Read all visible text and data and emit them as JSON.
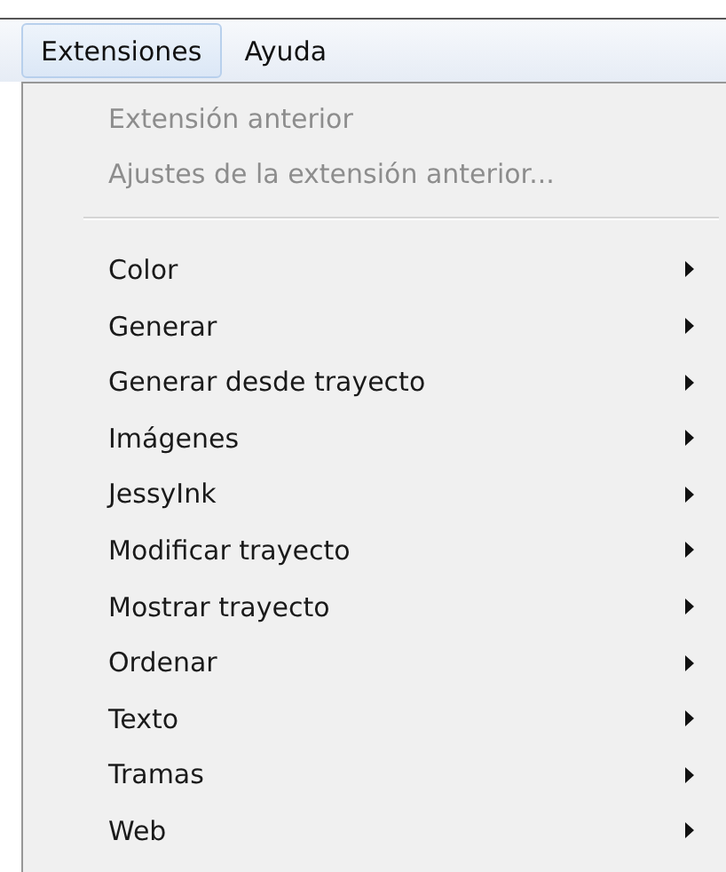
{
  "menubar": [
    {
      "label": "Extensiones",
      "selected": true
    },
    {
      "label": "Ayuda",
      "selected": false
    }
  ],
  "menu": [
    {
      "kind": "item",
      "label": "Extensión anterior",
      "disabled": true,
      "submenu": false
    },
    {
      "kind": "item",
      "label": "Ajustes de la extensión anterior...",
      "disabled": true,
      "submenu": false
    },
    {
      "kind": "separator"
    },
    {
      "kind": "item",
      "label": "Color",
      "disabled": false,
      "submenu": true
    },
    {
      "kind": "item",
      "label": "Generar",
      "disabled": false,
      "submenu": true
    },
    {
      "kind": "item",
      "label": "Generar desde trayecto",
      "disabled": false,
      "submenu": true
    },
    {
      "kind": "item",
      "label": "Imágenes",
      "disabled": false,
      "submenu": true
    },
    {
      "kind": "item",
      "label": "JessyInk",
      "disabled": false,
      "submenu": true
    },
    {
      "kind": "item",
      "label": "Modificar trayecto",
      "disabled": false,
      "submenu": true
    },
    {
      "kind": "item",
      "label": "Mostrar trayecto",
      "disabled": false,
      "submenu": true
    },
    {
      "kind": "item",
      "label": "Ordenar",
      "disabled": false,
      "submenu": true
    },
    {
      "kind": "item",
      "label": "Texto",
      "disabled": false,
      "submenu": true
    },
    {
      "kind": "item",
      "label": "Tramas",
      "disabled": false,
      "submenu": true
    },
    {
      "kind": "item",
      "label": "Web",
      "disabled": false,
      "submenu": true
    }
  ]
}
